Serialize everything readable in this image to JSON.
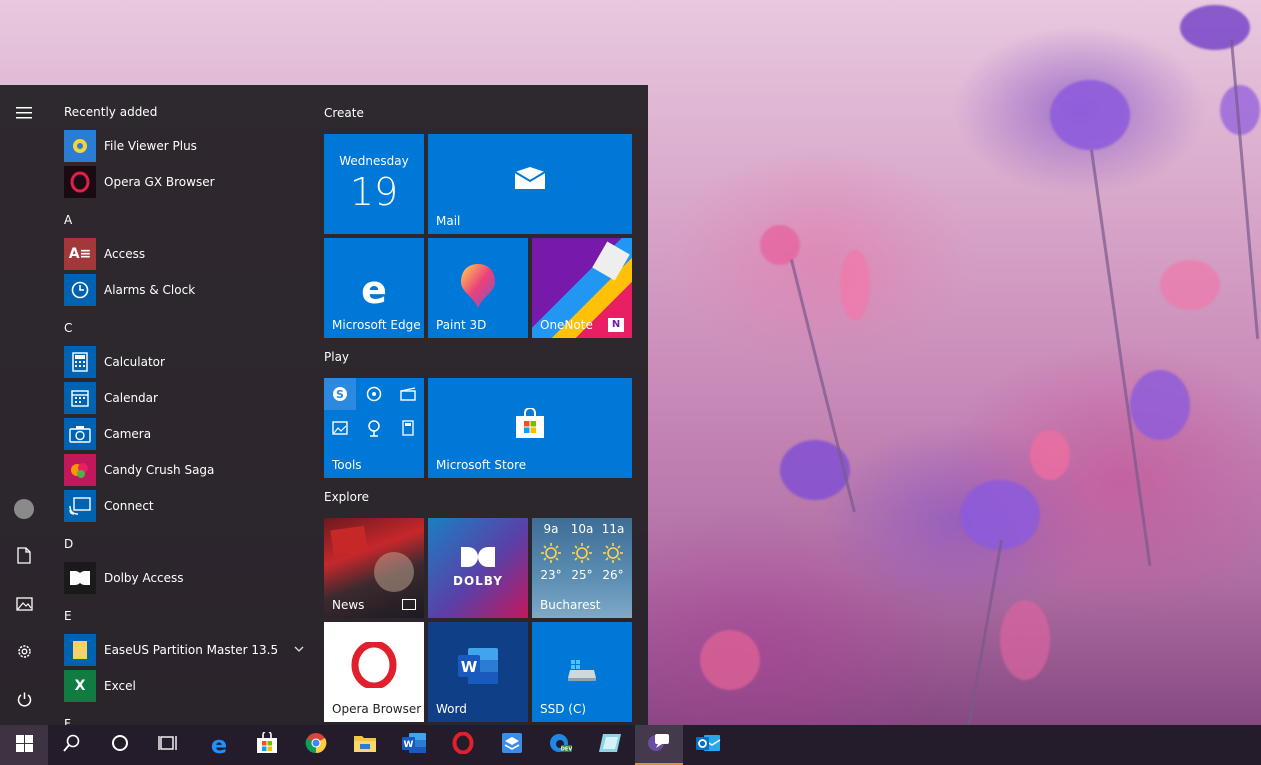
{
  "start_menu": {
    "rail": {
      "menu_icon": "hamburger-icon",
      "avatar_icon": "user-avatar-icon",
      "documents_icon": "document-icon",
      "pictures_icon": "pictures-icon",
      "settings_icon": "gear-icon",
      "power_icon": "power-icon"
    },
    "app_list": {
      "recently_added": "Recently added",
      "recent": [
        {
          "label": "File Viewer Plus",
          "icon": "file-viewer-icon",
          "color": "#2b7cd3"
        },
        {
          "label": "Opera GX Browser",
          "icon": "opera-gx-icon",
          "color": "#1a0a12"
        }
      ],
      "sections": [
        {
          "letter": "A",
          "items": [
            {
              "label": "Access",
              "icon": "access-icon",
              "color": "#a4373a",
              "glyph": "A"
            },
            {
              "label": "Alarms & Clock",
              "icon": "alarm-clock-icon",
              "color": "#0063b1",
              "glyph": "◷"
            }
          ]
        },
        {
          "letter": "C",
          "items": [
            {
              "label": "Calculator",
              "icon": "calculator-icon",
              "color": "#0063b1",
              "glyph": "▦"
            },
            {
              "label": "Calendar",
              "icon": "calendar-icon",
              "color": "#0063b1",
              "glyph": "▤"
            },
            {
              "label": "Camera",
              "icon": "camera-icon",
              "color": "#0063b1",
              "glyph": "◉"
            },
            {
              "label": "Candy Crush Saga",
              "icon": "candy-crush-icon",
              "color": "#c2185b",
              "glyph": "●"
            },
            {
              "label": "Connect",
              "icon": "connect-icon",
              "color": "#0063b1",
              "glyph": "▭"
            }
          ]
        },
        {
          "letter": "D",
          "items": [
            {
              "label": "Dolby Access",
              "icon": "dolby-icon",
              "color": "#1a1a1a",
              "glyph": "◨"
            }
          ]
        },
        {
          "letter": "E",
          "items": [
            {
              "label": "EaseUS Partition Master 13.5",
              "icon": "folder-icon",
              "color": "#0063b1",
              "glyph": "▮",
              "expandable": true
            },
            {
              "label": "Excel",
              "icon": "excel-icon",
              "color": "#107c41",
              "glyph": "X"
            }
          ]
        },
        {
          "letter": "F",
          "items": []
        }
      ]
    },
    "tiles": {
      "groups": [
        {
          "title": "Create"
        },
        {
          "title": "Play"
        },
        {
          "title": "Explore"
        }
      ],
      "calendar": {
        "day": "Wednesday",
        "date": "19"
      },
      "mail": {
        "label": "Mail"
      },
      "edge": {
        "label": "Microsoft Edge"
      },
      "paint3d": {
        "label": "Paint 3D"
      },
      "onenote": {
        "label": "OneNote"
      },
      "tools": {
        "label": "Tools"
      },
      "store": {
        "label": "Microsoft Store"
      },
      "news": {
        "label": "News"
      },
      "dolby": {
        "label": "DOLBY"
      },
      "weather": {
        "city": "Bucharest",
        "forecast": [
          {
            "time": "9a",
            "temp": "23°"
          },
          {
            "time": "10a",
            "temp": "25°"
          },
          {
            "time": "11a",
            "temp": "26°"
          }
        ]
      },
      "opera": {
        "label": "Opera Browser"
      },
      "word": {
        "label": "Word"
      },
      "ssd": {
        "label": "SSD (C)"
      }
    }
  },
  "taskbar": {
    "items": [
      {
        "icon": "windows-start-icon"
      },
      {
        "icon": "search-icon"
      },
      {
        "icon": "cortana-icon"
      },
      {
        "icon": "task-view-icon"
      },
      {
        "icon": "edge-icon",
        "color": "#0078d7"
      },
      {
        "icon": "store-icon",
        "color": "#ffffff"
      },
      {
        "icon": "chrome-icon",
        "color": "#4caf50"
      },
      {
        "icon": "file-explorer-icon",
        "color": "#f4c542"
      },
      {
        "icon": "word-icon",
        "color": "#2b579a"
      },
      {
        "icon": "opera-icon",
        "color": "#e0202c"
      },
      {
        "icon": "box-app-icon",
        "color": "#3a8ee6"
      },
      {
        "icon": "edge-dev-icon",
        "color": "#1e88e5"
      },
      {
        "icon": "paint-icon",
        "color": "#8fd3e8"
      },
      {
        "icon": "messenger-app-icon",
        "color": "#6a4fa0"
      },
      {
        "icon": "outlook-icon",
        "color": "#0072c6"
      }
    ]
  }
}
